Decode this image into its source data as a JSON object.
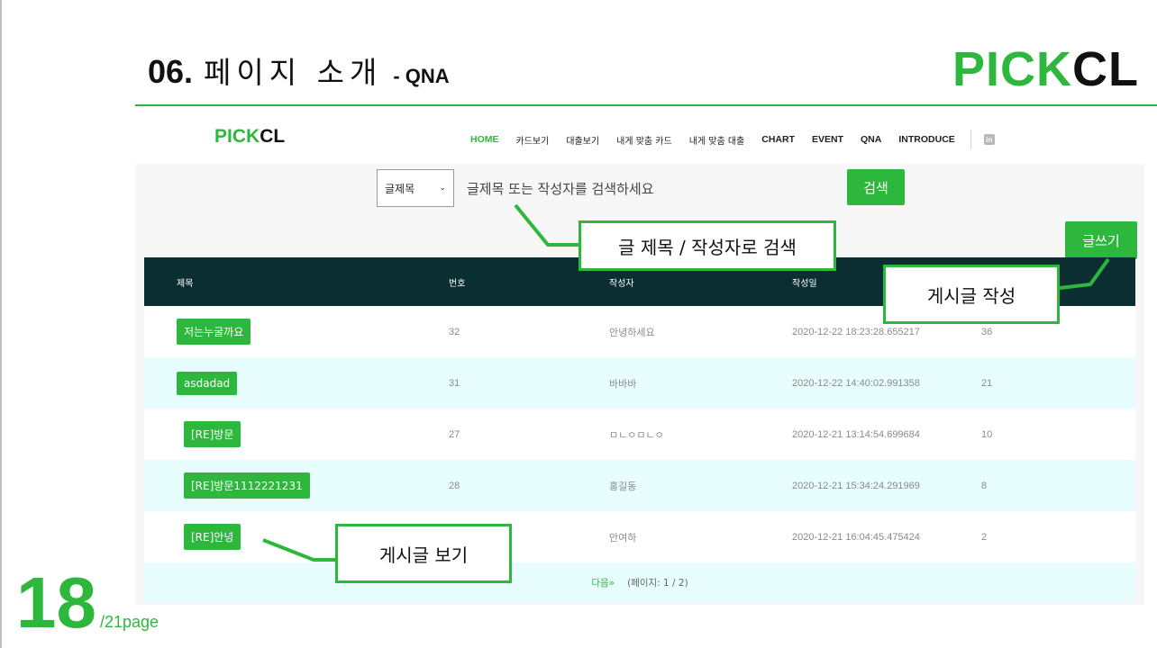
{
  "slide": {
    "number": "06.",
    "title": "페이지 소개",
    "subtitle": "- QNA",
    "brand_green": "PICK",
    "brand_dark": "CL",
    "page_current": "18",
    "page_total": "/21page"
  },
  "site": {
    "logo_green": "PICK",
    "logo_dark": "CL",
    "nav": [
      "HOME",
      "카드보기",
      "대출보기",
      "내게 맞춤 카드",
      "내게 맞춤 대출",
      "CHART",
      "EVENT",
      "QNA",
      "INTRODUCE"
    ],
    "active_nav": "HOME",
    "linkedin_icon": "linkedin-icon"
  },
  "search": {
    "select_value": "글제목",
    "placeholder": "글제목 또는 작성자를 검색하세요",
    "button": "검색"
  },
  "write_button": "글쓰기",
  "table": {
    "headers": [
      "제목",
      "번호",
      "작성자",
      "작성일",
      ""
    ],
    "rows": [
      {
        "title": "저는누굴까요",
        "no": "32",
        "author": "안녕하세요",
        "date": "2020-12-22 18:23:28.655217",
        "views": "36",
        "reply": false
      },
      {
        "title": "asdadad",
        "no": "31",
        "author": "바바바",
        "date": "2020-12-22 14:40:02.991358",
        "views": "21",
        "reply": false
      },
      {
        "title": "[RE]방문",
        "no": "27",
        "author": "ㅁㄴㅇㅁㄴㅇ",
        "date": "2020-12-21 13:14:54.699684",
        "views": "10",
        "reply": true
      },
      {
        "title": "[RE]방문1112221231",
        "no": "28",
        "author": "홍길동",
        "date": "2020-12-21 15:34:24.291969",
        "views": "8",
        "reply": true
      },
      {
        "title": "[RE]안녕",
        "no": "",
        "author": "안여하",
        "date": "2020-12-21 16:04:45.475424",
        "views": "2",
        "reply": true
      }
    ]
  },
  "pager": {
    "next": "다음»",
    "info": "(페이지: 1 / 2)"
  },
  "callouts": {
    "search": "글 제목 / 작성자로 검색",
    "write": "게시글 작성",
    "view": "게시글 보기"
  },
  "colors": {
    "accent": "#2db83d",
    "table_header": "#0b2e33",
    "row_alt": "#e8fdfd"
  }
}
